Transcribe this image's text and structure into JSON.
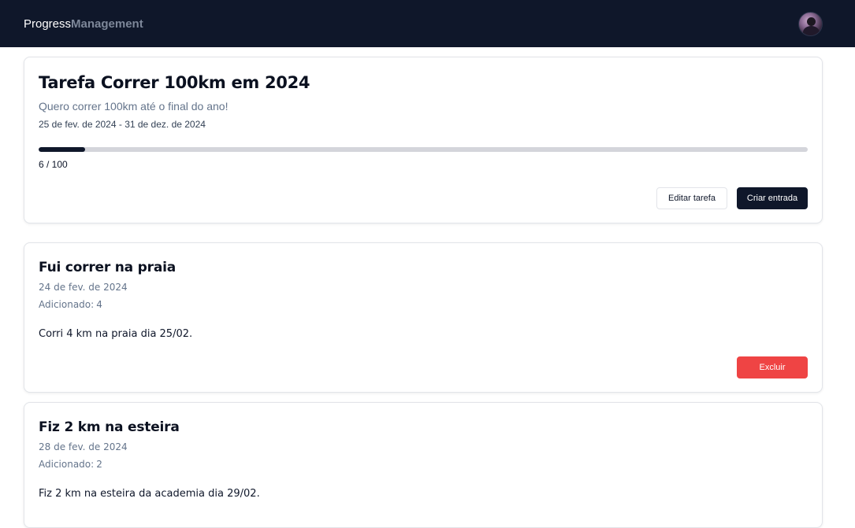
{
  "header": {
    "brand_part1": "Progress",
    "brand_part2": "Management",
    "avatar_alt": "user-avatar"
  },
  "task": {
    "title": "Tarefa Correr 100km em 2024",
    "description": "Quero correr 100km até o final do ano!",
    "dates": "25 de fev. de 2024 - 31 de dez. de 2024",
    "progress_current": 6,
    "progress_total": 100,
    "progress_text": "6 / 100",
    "edit_label": "Editar tarefa",
    "create_label": "Criar entrada"
  },
  "entries": [
    {
      "title": "Fui correr na praia",
      "date": "24 de fev. de 2024",
      "added_label": "Adicionado:",
      "added_value": "4",
      "body": "Corri 4 km na praia dia 25/02.",
      "delete_label": "Excluir"
    },
    {
      "title": "Fiz 2 km na esteira",
      "date": "28 de fev. de 2024",
      "added_label": "Adicionado:",
      "added_value": "2",
      "body": "Fiz 2 km na esteira da academia dia 29/02."
    }
  ],
  "colors": {
    "nav_bg": "#0f172a",
    "brand_accent": "#7d8799",
    "primary": "#0f172a",
    "danger": "#ef4444",
    "muted_text": "#64748b",
    "progress_track": "#d4d5db"
  }
}
